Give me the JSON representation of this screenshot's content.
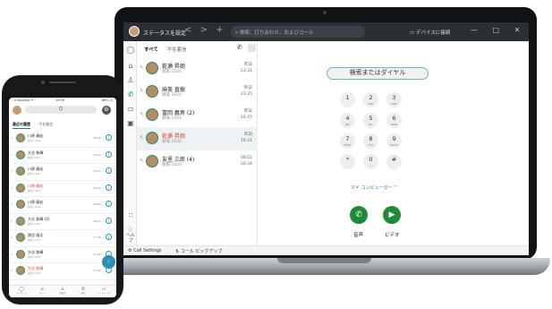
{
  "laptop": {
    "titlebar": {
      "status": "ステータスを設定",
      "nav": "< > +",
      "search_placeholder": "検索、打ち合わせ、およびコール",
      "device": "デバイスに接続",
      "window_controls": "— □ ✕"
    },
    "rail": {
      "icons": [
        "chat-icon",
        "people-icon",
        "user-icon",
        "phone-icon",
        "voicemail-icon",
        "calendar-icon"
      ],
      "help_label": "ヘルプ"
    },
    "pane": {
      "tabs": [
        "すべて",
        "不在着信"
      ],
      "contacts": [
        {
          "name": "乾瀬 昇朗",
          "sub": "職場 2000",
          "date": "昨日",
          "time": "23:31",
          "red": false
        },
        {
          "name": "麻美 直樹",
          "sub": "職場 2000",
          "date": "昨日",
          "time": "23:25",
          "red": false
        },
        {
          "name": "富岡 義男 (2)",
          "sub": "職場 2004",
          "date": "昨日",
          "time": "16:37",
          "red": false
        },
        {
          "name": "乾瀬 昇朗",
          "sub": "職場 2000",
          "date": "昨日",
          "time": "16:31",
          "red": true
        },
        {
          "name": "友里 三郎 (4)",
          "sub": "職場 2000",
          "date": "06/22",
          "time": "20:34",
          "red": false
        }
      ]
    },
    "dialer": {
      "input_placeholder": "検索またはダイヤル",
      "keys": [
        {
          "d": "1",
          "l": ""
        },
        {
          "d": "2",
          "l": "ABC"
        },
        {
          "d": "3",
          "l": "DEF"
        },
        {
          "d": "4",
          "l": "GHI"
        },
        {
          "d": "5",
          "l": "JKL"
        },
        {
          "d": "6",
          "l": "MNO"
        },
        {
          "d": "7",
          "l": "PQRS"
        },
        {
          "d": "8",
          "l": "TUV"
        },
        {
          "d": "9",
          "l": "WXYZ"
        },
        {
          "d": "*",
          "l": ""
        },
        {
          "d": "0",
          "l": "+"
        },
        {
          "d": "#",
          "l": ""
        }
      ],
      "my_computer": "マイ コンピューター ﹀",
      "audio_label": "音声",
      "video_label": "ビデオ"
    },
    "bottom": {
      "call_settings": "Call Settings",
      "call_pickup": "コール ピックアップ"
    }
  },
  "phone": {
    "status": {
      "left": "..il docomo ᯤ",
      "center": "19:59",
      "right": "86% ▭"
    },
    "search_label": "Q",
    "tabs": [
      "最近の履歴",
      "不在着信"
    ],
    "contacts": [
      {
        "name": "川原 康宏",
        "sub": "職場 2000",
        "time": "18:06",
        "red": false
      },
      {
        "name": "大谷 和輝",
        "sub": "職場 2000",
        "time": "18:04",
        "red": false
      },
      {
        "name": "川原 康宏",
        "sub": "職場 2000",
        "time": "18:03",
        "red": false
      },
      {
        "name": "川原 康宏",
        "sub": "職場 2000",
        "time": "18:00",
        "red": true
      },
      {
        "name": "川原 康宏",
        "sub": "職場 2000",
        "time": "18:00",
        "red": false
      },
      {
        "name": "大谷 和輝 (3)",
        "sub": "職場 2000",
        "time": "18:01",
        "red": false
      },
      {
        "name": "黒田 瑞太",
        "sub": "職場 2000",
        "time": "17:58",
        "red": false
      },
      {
        "name": "大谷 和輝",
        "sub": "職場 2000",
        "time": "17:56",
        "red": false
      },
      {
        "name": "大谷 和輝",
        "sub": "職場 2000",
        "time": "17:56",
        "red": true
      }
    ],
    "nav": [
      {
        "icon": "chat-icon",
        "label": "メッセージ"
      },
      {
        "icon": "people-icon",
        "label": "チーム"
      },
      {
        "icon": "user-icon",
        "label": "連絡先"
      },
      {
        "icon": "phone-icon",
        "label": "通話"
      },
      {
        "icon": "meeting-icon",
        "label": "ミーティング"
      }
    ]
  }
}
